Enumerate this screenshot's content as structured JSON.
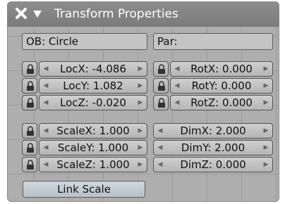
{
  "panel": {
    "title": "Transform Properties",
    "ob_field": "OB: Circle",
    "par_field": "Par:",
    "loc": {
      "x": "LocX: -4.086",
      "y": "LocY: 1.082",
      "z": "LocZ: -0.020"
    },
    "rot": {
      "x": "RotX: 0.000",
      "y": "RotY: 0.000",
      "z": "RotZ: 0.000"
    },
    "scale": {
      "x": "ScaleX: 1.000",
      "y": "ScaleY: 1.000",
      "z": "ScaleZ: 1.000"
    },
    "dim": {
      "x": "DimX: 2.000",
      "y": "DimY: 2.000",
      "z": "DimZ: 0.000"
    },
    "link_scale_label": "Link Scale"
  },
  "icons": [
    "close-icon",
    "collapse-triangle-icon",
    "lock-icon",
    "arrow-left-icon",
    "arrow-right-icon"
  ],
  "colors": {
    "panel_bg": "#aeaeae",
    "title_bg": "#7f7f7f",
    "title_text": "#ffffff",
    "button_bg": "#c4c4c4",
    "link_button_bg": "#c2ccd1"
  }
}
